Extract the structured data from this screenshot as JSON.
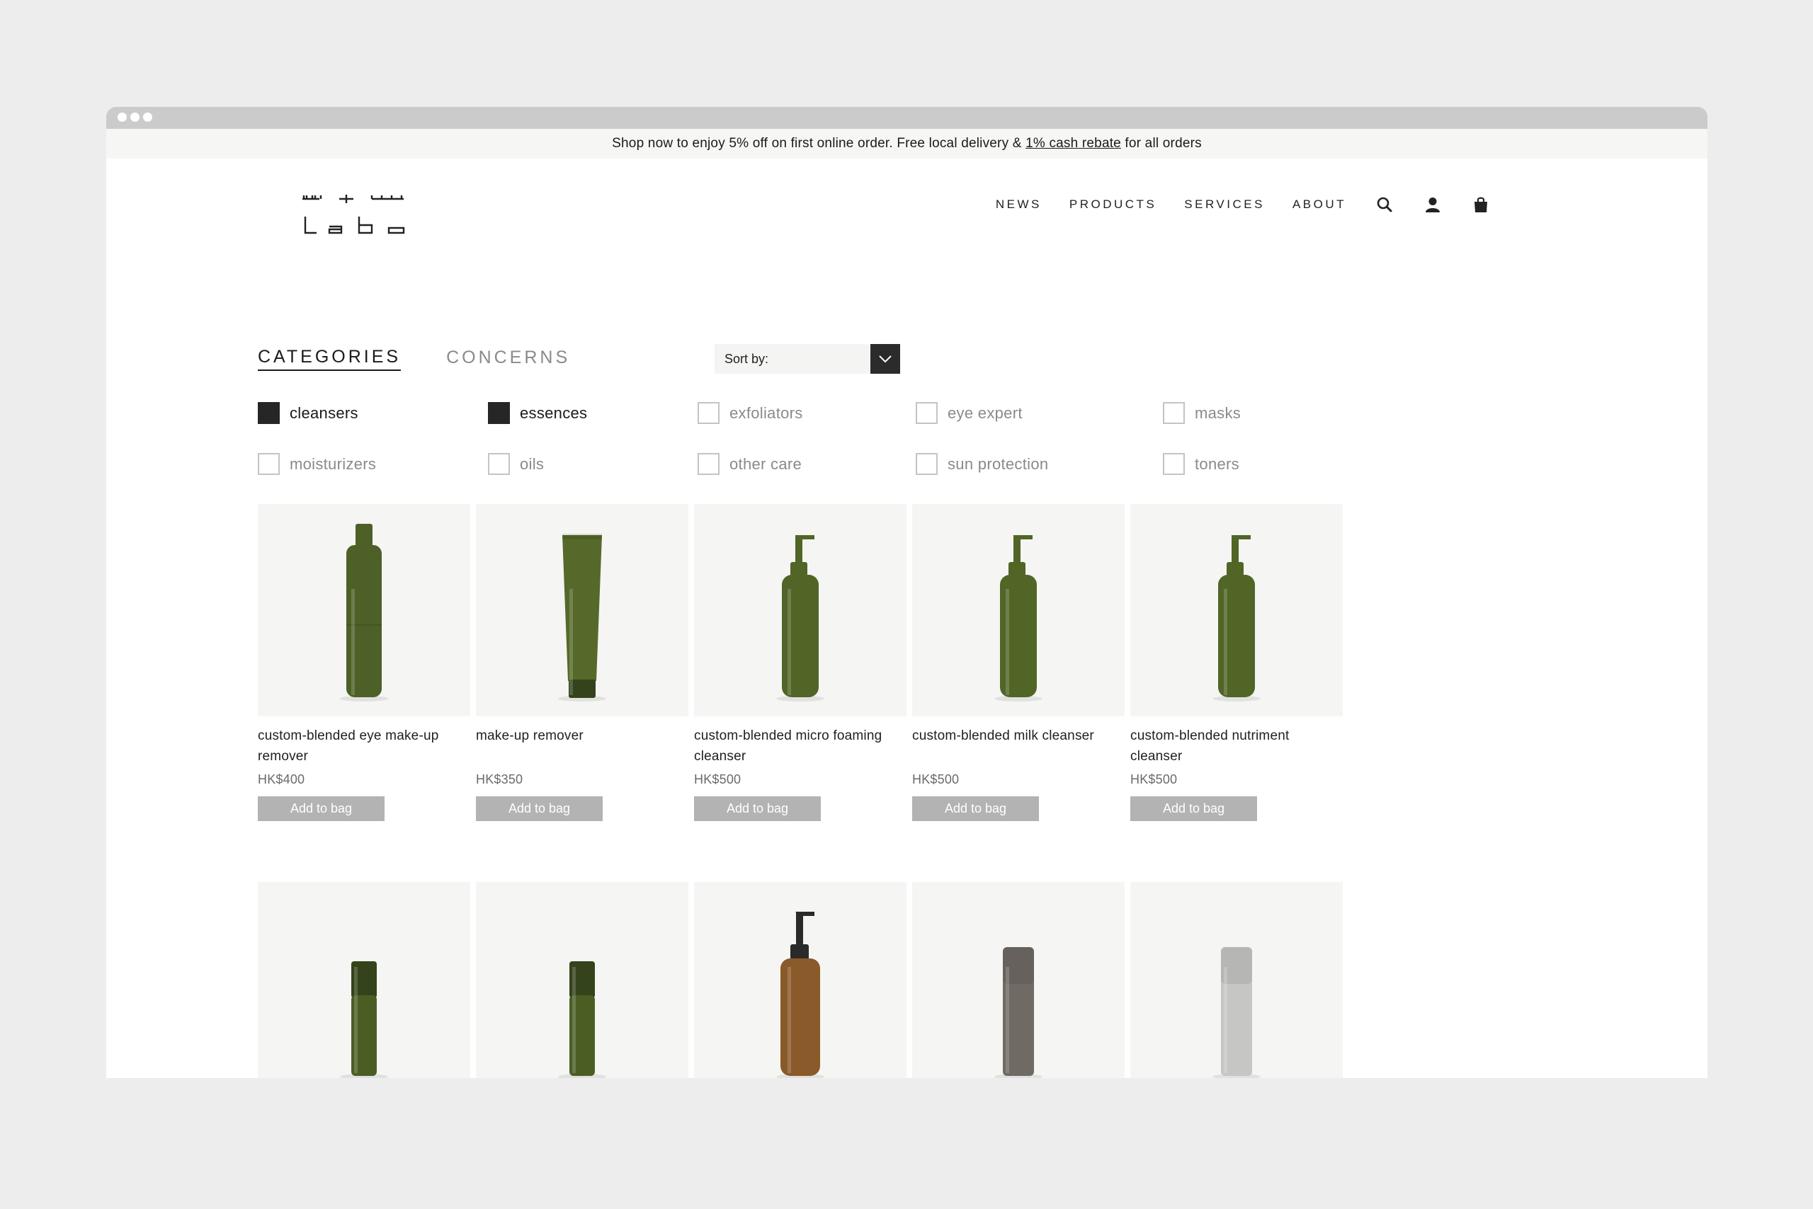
{
  "promo": {
    "text_before": "Shop now to enjoy 5% off on first online order. Free local delivery & ",
    "link": "1% cash rebate",
    "text_after": " for all orders"
  },
  "nav": {
    "links": [
      "NEWS",
      "PRODUCTS",
      "SERVICES",
      "ABOUT"
    ],
    "icons": [
      "search-icon",
      "account-icon",
      "shopping-bag-icon"
    ]
  },
  "filters": {
    "tabs": [
      "CATEGORIES",
      "CONCERNS"
    ],
    "active_tab": "CATEGORIES",
    "sort_label": "Sort by:"
  },
  "categories": [
    {
      "label": "cleansers",
      "checked": true
    },
    {
      "label": "essences",
      "checked": true
    },
    {
      "label": "exfoliators",
      "checked": false
    },
    {
      "label": "eye expert",
      "checked": false
    },
    {
      "label": "masks",
      "checked": false
    },
    {
      "label": "moisturizers",
      "checked": false
    },
    {
      "label": "oils",
      "checked": false
    },
    {
      "label": "other care",
      "checked": false
    },
    {
      "label": "sun protection",
      "checked": false
    },
    {
      "label": "toners",
      "checked": false
    }
  ],
  "products": [
    {
      "name": "custom-blended eye make-up remover",
      "price": "HK$400",
      "button": "Add to bag",
      "color": "#4d6027",
      "shape": "bottle"
    },
    {
      "name": "make-up remover",
      "price": "HK$350",
      "button": "Add to bag",
      "color": "#56692a",
      "shape": "tube"
    },
    {
      "name": "custom-blended micro foaming cleanser",
      "price": "HK$500",
      "button": "Add to bag",
      "color": "#516527",
      "shape": "pump"
    },
    {
      "name": "custom-blended milk cleanser",
      "price": "HK$500",
      "button": "Add to bag",
      "color": "#516527",
      "shape": "pump"
    },
    {
      "name": "custom-blended nutriment cleanser",
      "price": "HK$500",
      "button": "Add to bag",
      "color": "#516527",
      "shape": "pump"
    },
    {
      "color": "#4a5e24",
      "shape": "small"
    },
    {
      "color": "#4a5e24",
      "shape": "small"
    },
    {
      "color": "#8a5a2a",
      "shape": "pump-tall"
    },
    {
      "color": "#6f6a64",
      "shape": "slim"
    },
    {
      "color": "#c6c6c4",
      "shape": "slim"
    }
  ]
}
